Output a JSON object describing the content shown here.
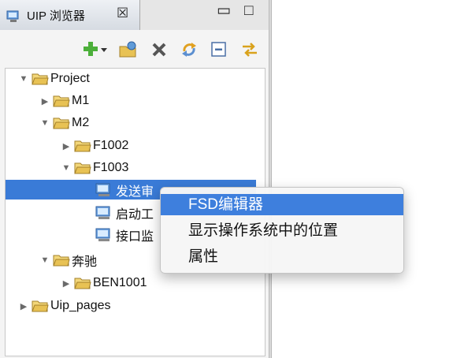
{
  "view": {
    "tab_title": "UIP 浏览器",
    "close_glyph": "☒",
    "minimize_glyph": "▭",
    "maximize_glyph": "□"
  },
  "toolbar": {
    "buttons": [
      "add-dropdown-icon",
      "open-folder-icon",
      "delete-icon",
      "refresh-icon",
      "collapse-all-icon",
      "link-editor-icon"
    ]
  },
  "tree": {
    "nodes": [
      {
        "label": "Project",
        "type": "folder",
        "state": "expanded"
      },
      {
        "label": "M1",
        "type": "folder",
        "state": "collapsed"
      },
      {
        "label": "M2",
        "type": "folder",
        "state": "expanded"
      },
      {
        "label": "F1002",
        "type": "folder",
        "state": "collapsed"
      },
      {
        "label": "F1003",
        "type": "folder",
        "state": "expanded"
      },
      {
        "label": "发送审",
        "type": "page",
        "state": "selected"
      },
      {
        "label": "启动工",
        "type": "page",
        "state": "leaf"
      },
      {
        "label": "接口监",
        "type": "page",
        "state": "leaf"
      },
      {
        "label": "奔驰",
        "type": "folder",
        "state": "expanded"
      },
      {
        "label": "BEN1001",
        "type": "folder",
        "state": "collapsed"
      },
      {
        "label": "Uip_pages",
        "type": "folder",
        "state": "collapsed"
      }
    ]
  },
  "context_menu": {
    "items": [
      "FSD编辑器",
      "显示操作系统中的位置",
      "属性"
    ],
    "active_index": 0
  },
  "colors": {
    "selection": "#3a7bd7",
    "menu_highlight": "#3e7fdd",
    "folder": "#e8c254"
  }
}
